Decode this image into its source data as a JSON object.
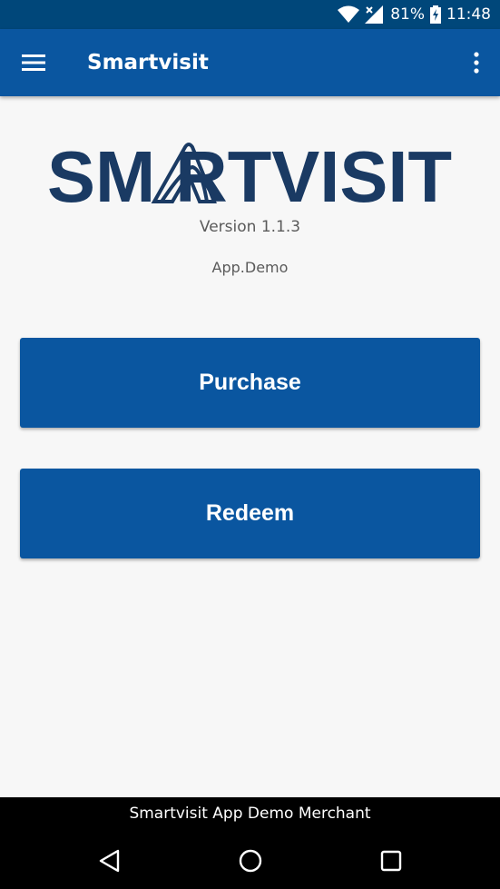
{
  "status_bar": {
    "battery": "81%",
    "time": "11:48",
    "icons": [
      "wifi-icon",
      "signal-icon",
      "battery-charging-icon"
    ]
  },
  "app_bar": {
    "title": "Smartvisit",
    "icons": [
      "menu-icon",
      "overflow-menu-icon"
    ]
  },
  "logo": {
    "text": "SMARTVISIT",
    "color": "#1a3a63"
  },
  "info": {
    "version": "Version 1.1.3",
    "app_name": "App.Demo"
  },
  "buttons": {
    "purchase": "Purchase",
    "redeem": "Redeem"
  },
  "footer": {
    "merchant": "Smartvisit App Demo Merchant"
  },
  "nav": {
    "icons": [
      "back-icon",
      "home-icon",
      "recents-icon"
    ]
  },
  "colors": {
    "status_bar": "#00477a",
    "primary": "#0a56a0",
    "background": "#f7f7f7"
  }
}
